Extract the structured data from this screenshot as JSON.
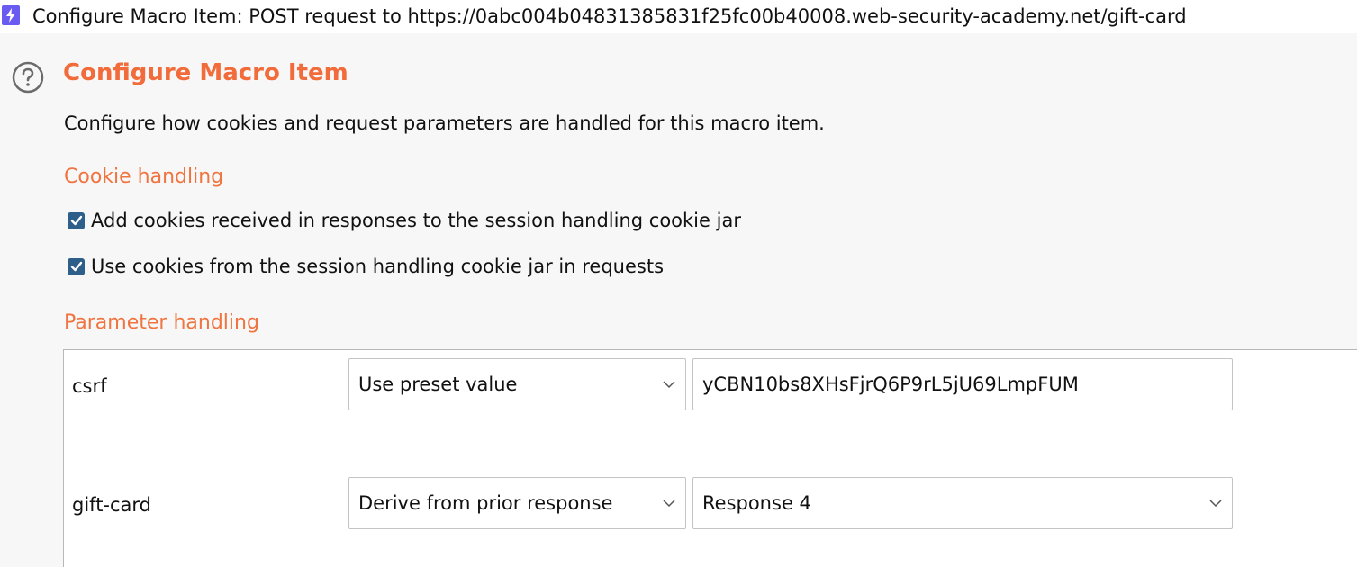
{
  "window": {
    "title": "Configure Macro Item: POST request to https://0abc004b04831385831f25fc00b40008.web-security-academy.net/gift-card",
    "icon": "burp-lightning-icon"
  },
  "header": {
    "title": "Configure Macro Item",
    "help_icon": "help-icon",
    "description": "Configure how cookies and request parameters are handled for this macro item."
  },
  "cookie_handling": {
    "title": "Cookie handling",
    "options": [
      {
        "label": "Add cookies received in responses to the session handling cookie jar",
        "checked": true
      },
      {
        "label": "Use cookies from the session handling cookie jar in requests",
        "checked": true
      }
    ]
  },
  "parameter_handling": {
    "title": "Parameter handling",
    "rows": [
      {
        "name": "csrf",
        "mode": "Use preset value",
        "value": "yCBN10bs8XHsFjrQ6P9rL5jU69LmpFUM"
      },
      {
        "name": "gift-card",
        "mode": "Derive from prior response",
        "value": "Response 4"
      }
    ]
  },
  "colors": {
    "accent": "#f26b3a",
    "checkbox": "#2e5f8a",
    "app_icon": "#6a5cf0"
  }
}
